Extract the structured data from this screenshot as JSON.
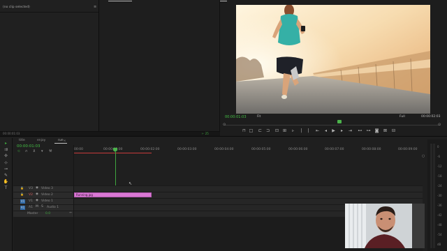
{
  "source_panel": {
    "no_clip_text": "(no clip selected)",
    "timecode": "00:00:01:03"
  },
  "program": {
    "timecode_left": "00:00:01:03",
    "fit_label": "Fit",
    "quality_label": "Full",
    "timecode_right": "00:00:02:03",
    "video_description": "Woman running on a bridge road at sunset, rear view",
    "controls": [
      "⊓",
      "□",
      "⊏",
      "⊐",
      "⇤",
      "⊳",
      "⊲",
      "|",
      "|",
      "⇤",
      "◂",
      "▶",
      "▸",
      "⇥",
      "⊞",
      "⊟",
      "⊡",
      "⊠",
      "⚙"
    ]
  },
  "tabs": [
    {
      "label": "title"
    },
    {
      "label": "enjoy"
    },
    {
      "label": "run"
    }
  ],
  "timeline": {
    "timecode": "00:00:01:03",
    "ruler": [
      "00:00",
      "00:00:01:00",
      "00:00:02:00",
      "00:00:03:00",
      "00:00:04:00",
      "00:00:05:00",
      "00:00:06:00",
      "00:00:07:00",
      "00:00:08:00",
      "00:00:09:00"
    ],
    "tracks": [
      {
        "id": "V3",
        "name": "Video 3",
        "kind": "video"
      },
      {
        "id": "V2",
        "name": "Video 2",
        "kind": "video"
      },
      {
        "id": "V1",
        "name": "Video 1",
        "kind": "video"
      },
      {
        "id": "A1",
        "name": "Audio 1",
        "kind": "audio"
      }
    ],
    "master_label": "Master",
    "master_value": "0.0",
    "clip_name": "Running.jpg",
    "clip_color": "#d978d4"
  },
  "meter": {
    "ticks": [
      "0",
      "-6",
      "-12",
      "-18",
      "-24",
      "-30",
      "-36",
      "-42",
      "-48",
      "-54",
      "dB"
    ]
  },
  "colors": {
    "accent_green": "#3fa63f",
    "playhead": "#4bb34b",
    "clip": "#d978d4",
    "timecode_green": "#46c146"
  },
  "icons": [
    "selection-icon",
    "track-select-icon",
    "ripple-icon",
    "razor-icon",
    "slip-icon",
    "pen-icon",
    "hand-icon",
    "text-icon",
    "wrench-icon",
    "magnet-icon"
  ]
}
